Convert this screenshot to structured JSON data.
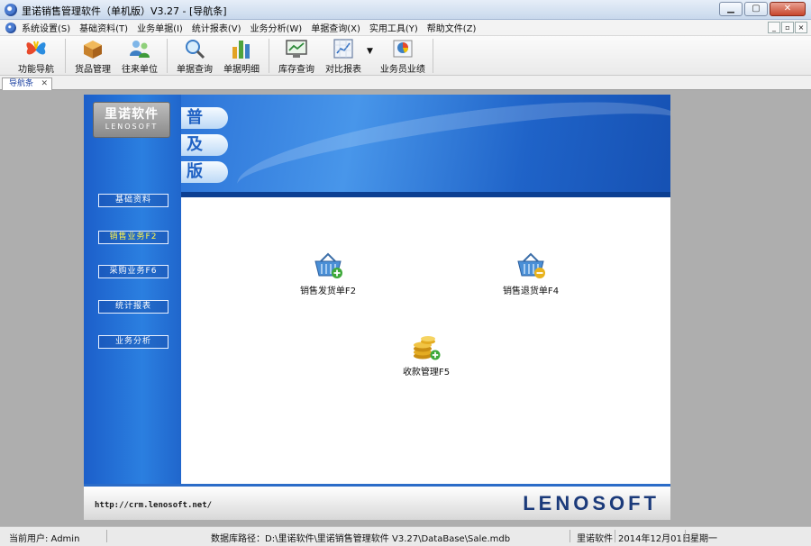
{
  "window": {
    "title": "里诺销售管理软件（单机版）V3.27 - [导航条]",
    "controls": [
      "minimize",
      "maximize",
      "close"
    ]
  },
  "menubar": {
    "items": [
      "系统设置(S)",
      "基础资料(T)",
      "业务单据(I)",
      "统计报表(V)",
      "业务分析(W)",
      "单据查询(X)",
      "实用工具(Y)",
      "帮助文件(Z)"
    ]
  },
  "toolbar": {
    "items": [
      {
        "label": "功能导航",
        "icon": "butterfly-icon"
      },
      {
        "label": "货品管理",
        "icon": "box-icon"
      },
      {
        "label": "往来单位",
        "icon": "users-icon"
      },
      {
        "label": "单据查询",
        "icon": "magnifier-icon"
      },
      {
        "label": "单据明细",
        "icon": "bar-chart-icon"
      },
      {
        "label": "库存查询",
        "icon": "monitor-icon"
      },
      {
        "label": "对比报表",
        "icon": "report-icon"
      },
      {
        "label": "业务员业绩",
        "icon": "pie-chart-icon"
      }
    ]
  },
  "tabs": [
    {
      "label": "导航条",
      "close": "✕"
    }
  ],
  "panel": {
    "logo_cn": "里诺软件",
    "logo_en": "LENOSOFT",
    "edition_chars": [
      "普",
      "及",
      "版"
    ],
    "side_buttons": [
      {
        "label": "基础资料",
        "active": false
      },
      {
        "label": "销售业务F2",
        "active": true
      },
      {
        "label": "采购业务F6",
        "active": false
      },
      {
        "label": "统计报表",
        "active": false
      },
      {
        "label": "业务分析",
        "active": false
      }
    ],
    "functions": [
      {
        "label": "销售发货单F2",
        "icon": "basket-add-icon"
      },
      {
        "label": "销售退货单F4",
        "icon": "basket-minus-icon"
      },
      {
        "label": "收款管理F5",
        "icon": "coins-add-icon"
      }
    ],
    "footer_url": "http://crm.lenosoft.net/",
    "footer_brand": "LENOSOFT"
  },
  "statusbar": {
    "user": "当前用户: Admin",
    "db_path": "数据库路径：D:\\里诺软件\\里诺销售管理软件 V3.27\\DataBase\\Sale.mdb",
    "company": "里诺软件",
    "date": "2014年12月01日",
    "weekday": "星期一"
  }
}
